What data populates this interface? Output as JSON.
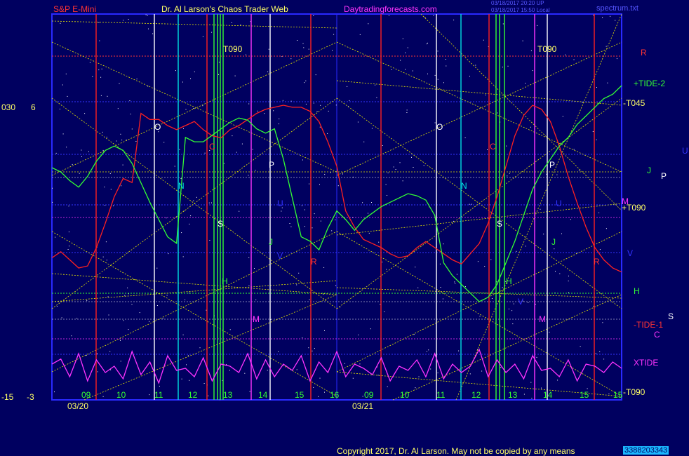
{
  "header": {
    "instrument": "S&P E-Mini",
    "title": "Dr. Al Larson's Chaos Trader Web",
    "site": "Daytradingforecasts.com",
    "stamp_line1": "03/18/2017 20:20 UP",
    "stamp_line2": "03/18/2017 15:50 Local",
    "file": "spectrum.txt"
  },
  "left_axis": {
    "top_a": "030",
    "top_b": "6",
    "bottom_a": "-15",
    "bottom_b": "-3"
  },
  "footer": {
    "copyright": "Copyright 2017, Dr. Al Larson. May not be copied by any means",
    "counter": "3388203343"
  },
  "colors": {
    "background": "#000060",
    "frame": "#2a2aff",
    "price": "#ff2020",
    "tide": "#33ff33",
    "xtide": "#ff33ff",
    "dotted": "#e6e600",
    "text_red": "#ff3333",
    "text_yellow": "#ffff66",
    "text_site": "#ff33ff"
  },
  "chart_data": {
    "type": "line",
    "x_label_hours": [
      "09",
      "10",
      "11",
      "12",
      "13",
      "14",
      "15",
      "16",
      "09",
      "10",
      "11",
      "12",
      "13",
      "14",
      "15",
      "15"
    ],
    "dates": [
      "03/20",
      "03/21"
    ],
    "series": [
      {
        "name": "R",
        "color": "#ff2020",
        "values": [
          0.25,
          0.28,
          0.24,
          0.2,
          0.21,
          0.3,
          0.42,
          0.55,
          0.64,
          0.62,
          0.96,
          0.93,
          0.93,
          0.9,
          0.88,
          0.9,
          0.92,
          0.88,
          0.85,
          0.84,
          0.88,
          0.9,
          0.93,
          0.96,
          0.98,
          0.99,
          1.0,
          0.99,
          0.99,
          0.97,
          0.92,
          0.82,
          0.7,
          0.48,
          0.4,
          0.34,
          0.32,
          0.3,
          0.27,
          0.25,
          0.26,
          0.3,
          0.33,
          0.3,
          0.27,
          0.24,
          0.22,
          0.27,
          0.32,
          0.42,
          0.55,
          0.7,
          0.85,
          0.95,
          1.0,
          0.98,
          0.92,
          0.8,
          0.65,
          0.52,
          0.4,
          0.3,
          0.24,
          0.2,
          0.18
        ]
      },
      {
        "name": "TIDE-2",
        "color": "#33ff33",
        "values": [
          0.62,
          0.6,
          0.56,
          0.53,
          0.58,
          0.65,
          0.7,
          0.72,
          0.7,
          0.64,
          0.55,
          0.46,
          0.38,
          0.3,
          0.27,
          0.76,
          0.74,
          0.74,
          0.77,
          0.8,
          0.83,
          0.85,
          0.84,
          0.8,
          0.78,
          0.8,
          0.66,
          0.48,
          0.3,
          0.28,
          0.24,
          0.34,
          0.42,
          0.38,
          0.33,
          0.38,
          0.41,
          0.44,
          0.46,
          0.48,
          0.5,
          0.49,
          0.47,
          0.4,
          0.18,
          0.12,
          0.08,
          0.04,
          0.0,
          0.02,
          0.08,
          0.18,
          0.28,
          0.4,
          0.52,
          0.6,
          0.66,
          0.72,
          0.76,
          0.82,
          0.86,
          0.9,
          0.94,
          0.96,
          1.0
        ]
      },
      {
        "name": "XTIDE",
        "color": "#ff33ff",
        "values": [
          0.6,
          0.72,
          0.3,
          0.85,
          0.2,
          0.7,
          0.4,
          0.55,
          0.25,
          0.9,
          0.35,
          0.65,
          0.15,
          0.8,
          0.45,
          0.5,
          0.3,
          0.75,
          0.2,
          0.6,
          0.55,
          0.4,
          0.85,
          0.25,
          0.7,
          0.3,
          0.6,
          0.45,
          0.8,
          0.2,
          0.65,
          0.4,
          0.9,
          0.3,
          0.6,
          0.5,
          0.35,
          0.75,
          0.2,
          0.55,
          0.45,
          0.7,
          0.3,
          0.85,
          0.25,
          0.6,
          0.4,
          0.55,
          0.95,
          0.3,
          0.7,
          0.4,
          0.6,
          0.25,
          0.8,
          0.45,
          0.5,
          0.3,
          0.7,
          0.2,
          0.6,
          0.55,
          0.4,
          0.65,
          0.5
        ]
      }
    ],
    "marker_labels": [
      "O",
      "N",
      "C",
      "S",
      "H",
      "P",
      "M",
      "J",
      "U",
      "V",
      "R"
    ],
    "right_labels": [
      "R",
      "+TIDE-2",
      "-T045",
      "U",
      "J",
      "P",
      "M",
      "+T090",
      "V",
      "H",
      "S",
      "-TIDE-1",
      "C",
      "XTIDE",
      "-T090",
      "T090"
    ]
  }
}
